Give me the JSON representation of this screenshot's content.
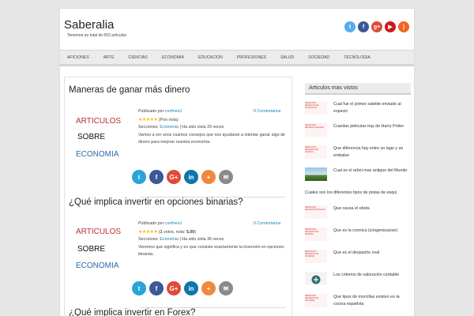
{
  "header": {
    "title": "Saberalia",
    "tagline": "Tenemos un total de 653 artículos",
    "social": [
      {
        "name": "twitter",
        "glyph": "t",
        "color": "#55acee"
      },
      {
        "name": "facebook",
        "glyph": "f",
        "color": "#3b5998"
      },
      {
        "name": "google-plus",
        "glyph": "g+",
        "color": "#dd4b39"
      },
      {
        "name": "youtube",
        "glyph": "▶",
        "color": "#cc181e"
      },
      {
        "name": "rss",
        "glyph": ")",
        "color": "#f26522"
      }
    ]
  },
  "nav": [
    "AFICIONES",
    "ARTE",
    "CIENCIAS",
    "ECONOMIA",
    "EDUCACION",
    "PROFESIONES",
    "SALUD",
    "SOCIEDAD",
    "TECNOLOGIA"
  ],
  "posts": [
    {
      "title": "Maneras de ganar más dinero",
      "author_prefix": "Publicado por",
      "author": "confnes1",
      "comments": "0 Comentarios",
      "rating_text": "(Pon nota)",
      "votes_prefix": "",
      "votes_value": "",
      "votes_suffix": "",
      "sections_label": "Secciones:",
      "section": "Economia",
      "views": "| Ha sido vista 29 veces",
      "excerpt": "Vamos a ver unos cuantos consejos que nos ayudaran a intentar ganar algo de dinero para mejorar nuestra economía.",
      "image_lines": [
        "ARTICULOS",
        "SOBRE",
        "ECONOMIA"
      ]
    },
    {
      "title": "¿Qué implica invertir en opciones binarias?",
      "author_prefix": "Publicado por",
      "author": "confnes1",
      "comments": "0 Comentarios",
      "rating_text": "",
      "votes_prefix": "(",
      "votes_value": "1",
      "votes_suffix": " votos, nota: ",
      "votes_score": "5,00",
      "votes_end": ")",
      "sections_label": "Secciones:",
      "section": "Economia",
      "views": "| Ha sido vista 36 veces",
      "excerpt": "Veremos que significa y en que consiste exactamente la inversión en opciones binarias.",
      "image_lines": [
        "ARTICULOS",
        "SOBRE",
        "ECONOMIA"
      ]
    },
    {
      "title": "¿Qué implica invertir en Forex?"
    }
  ],
  "share_buttons": [
    {
      "name": "twitter",
      "glyph": "t",
      "color": "#2aa3d8"
    },
    {
      "name": "facebook",
      "glyph": "f",
      "color": "#3b5998"
    },
    {
      "name": "google-plus",
      "glyph": "G+",
      "color": "#dd4b39"
    },
    {
      "name": "linkedin",
      "glyph": "in",
      "color": "#0e76a8"
    },
    {
      "name": "share",
      "glyph": "+",
      "color": "#f0883e"
    },
    {
      "name": "email",
      "glyph": "✉",
      "color": "#8a8a8a"
    }
  ],
  "sidebar": {
    "title": "Articulos mas vistos",
    "items": [
      {
        "text": "Cual fue el primer satelite enviado al espacio",
        "thumb": "PREGUNTAS RESUELTAS DE TECNOLOGIA"
      },
      {
        "text": "Cuantas peliculas hay de Harry Potter",
        "thumb": "PREGUNTAS RESUELTAS DE ARTE"
      },
      {
        "text": "Que diferencia hay entre un lago y un embalse",
        "thumb": "PREGUNTAS RESUELTAS DE CIENCIAS"
      },
      {
        "text": "Cual es el arbol mas antiguo del Mundo",
        "thumb": ""
      },
      {
        "text": "Cuales son los diferentes tipos de pistas de esqui",
        "thumb": ""
      },
      {
        "text": "Que causa el ebola",
        "thumb": "PREGUNTAS RESUELTAS DE SALUD"
      },
      {
        "text": "Que es la crionica (criogenizacion)",
        "thumb": "PREGUNTAS RESUELTAS DE CIENCIAS"
      },
      {
        "text": "Que es el despacho oval",
        "thumb": "PREGUNTAS RESUELTAS DE SOCIEDAD"
      },
      {
        "text": "Los criterios de valoración contable",
        "thumb": ""
      },
      {
        "text": "Que tipos de morcillas existen en la cocina española",
        "thumb": "PREGUNTAS RESUELTAS DE AFICIONES"
      }
    ]
  }
}
